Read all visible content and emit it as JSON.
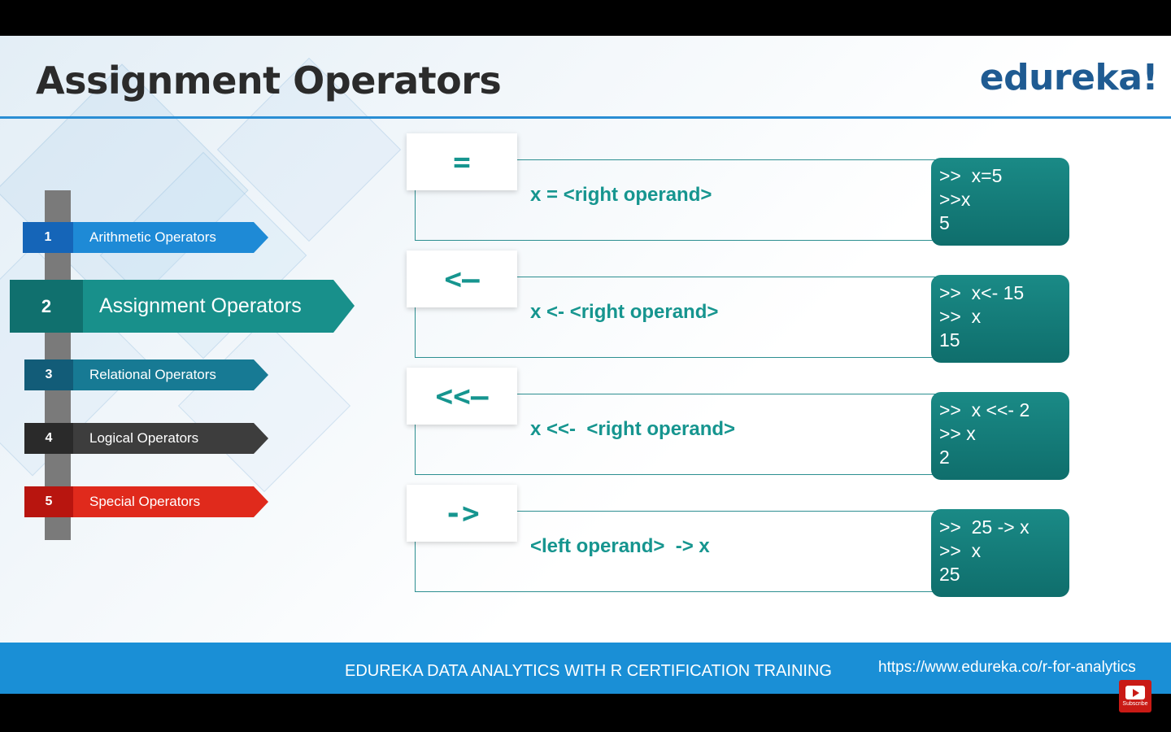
{
  "slide": {
    "title": "Assignment Operators",
    "logo": "edureka!"
  },
  "nav": {
    "items": [
      {
        "num": "1",
        "label": "Arithmetic Operators"
      },
      {
        "num": "2",
        "label": "Assignment Operators"
      },
      {
        "num": "3",
        "label": "Relational Operators"
      },
      {
        "num": "4",
        "label": "Logical Operators"
      },
      {
        "num": "5",
        "label": "Special Operators"
      }
    ],
    "active_index": 1
  },
  "operators": [
    {
      "symbol": "=",
      "syntax": "x = <right operand>",
      "code": ">>  x=5\n>>x\n5"
    },
    {
      "symbol": "<–",
      "syntax": "x <- <right operand>",
      "code": ">>  x<- 15\n>>  x\n15"
    },
    {
      "symbol": "<<–",
      "syntax": "x <<-  <right operand>",
      "code": ">>  x <<- 2\n>> x\n2"
    },
    {
      "symbol": "->",
      "syntax": "<left operand>  -> x",
      "code": ">>  25 -> x\n>>  x\n25"
    }
  ],
  "footer": {
    "text": "EDUREKA DATA ANALYTICS WITH R CERTIFICATION TRAINING",
    "url": "https://www.edureka.co/r-for-analytics"
  },
  "subscribe": {
    "label": "Subscribe"
  },
  "colors": {
    "accent_teal": "#16958f",
    "footer_blue": "#1a8fd6",
    "title_rule": "#2a8ed4",
    "logo_blue": "#1f5b92"
  }
}
